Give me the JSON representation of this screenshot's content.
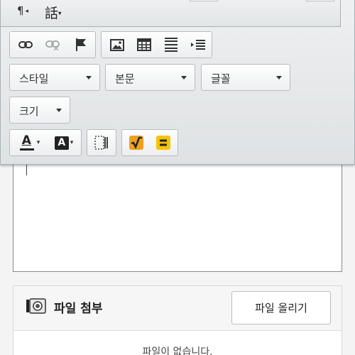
{
  "toolbar": {
    "paragraph_symbol": "¶",
    "paragraph_arrow": "◂",
    "hanja_label": "話",
    "link_icon": "link-icon",
    "unlink_icon": "unlink-icon",
    "anchor_icon": "flag-icon",
    "image_icon": "image-icon",
    "table_icon": "table-icon",
    "hr_icon": "horizontal-line-icon",
    "indent_icon": "indent-icon",
    "style_label": "스타일",
    "format_label": "본문",
    "font_label": "글꼴",
    "size_label": "크기",
    "text_color_letter": "A",
    "bg_color_letter": "A",
    "accent_yellow": "#f5c400",
    "accent_orange": "#f0a020"
  },
  "attachment": {
    "title": "파일 첨부",
    "upload_button": "파일 올리기",
    "empty_message": "파일이 없습니다."
  }
}
